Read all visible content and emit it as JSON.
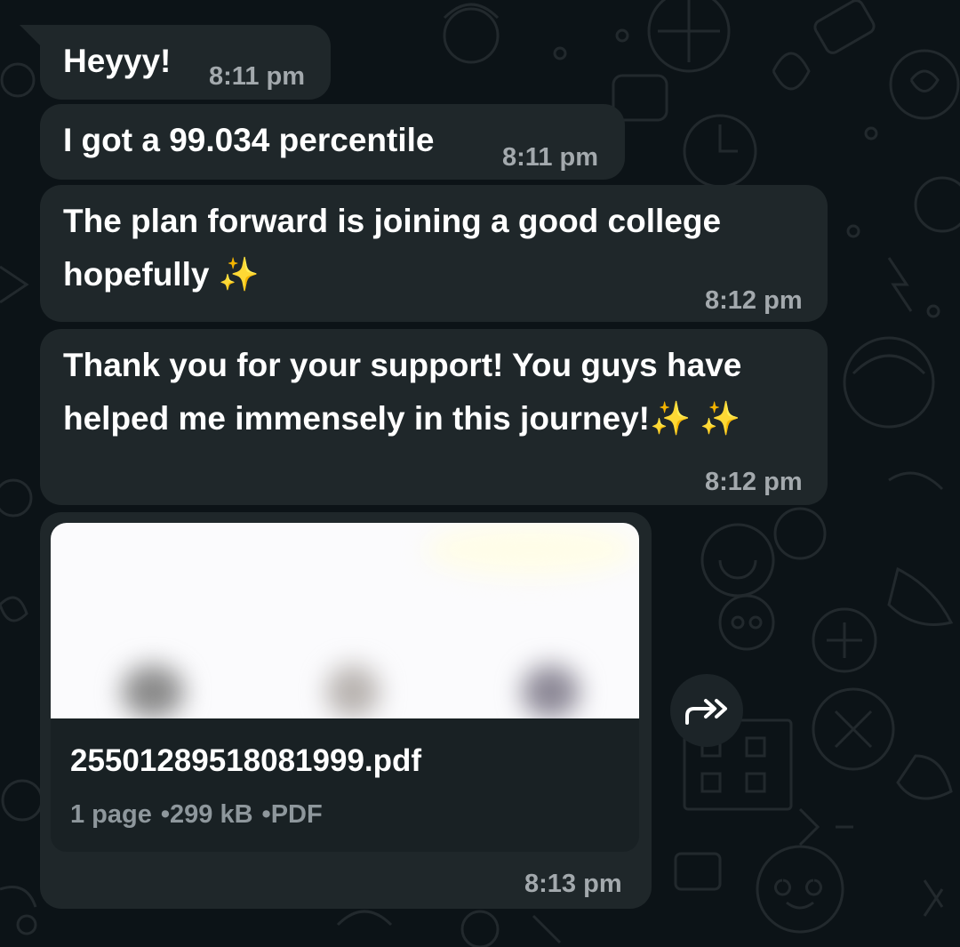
{
  "messages": [
    {
      "text": "Heyyy!",
      "time": "8:11 pm"
    },
    {
      "text": "I got a 99.034 percentile",
      "time": "8:11 pm"
    },
    {
      "line1": "The plan forward is joining a good college",
      "line2": "hopefully",
      "emoji": "✨",
      "time": "8:12 pm"
    },
    {
      "line1": "Thank you for your support! You guys have",
      "line2": "helped me immensely in this journey!",
      "emoji": "✨ ✨",
      "time": "8:12 pm"
    }
  ],
  "document": {
    "filename": "25501289518081999.pdf",
    "pages": "1 page",
    "size": "299 kB",
    "type": "PDF",
    "separator": "•",
    "time": "8:13 pm"
  },
  "icons": {
    "forward": "forward-icon",
    "sparkles": "sparkles-icon"
  },
  "colors": {
    "background": "#0c1317",
    "bubble": "#1f272a",
    "timestamp": "#a3a9ad",
    "sparkle": "#f7d64a"
  }
}
